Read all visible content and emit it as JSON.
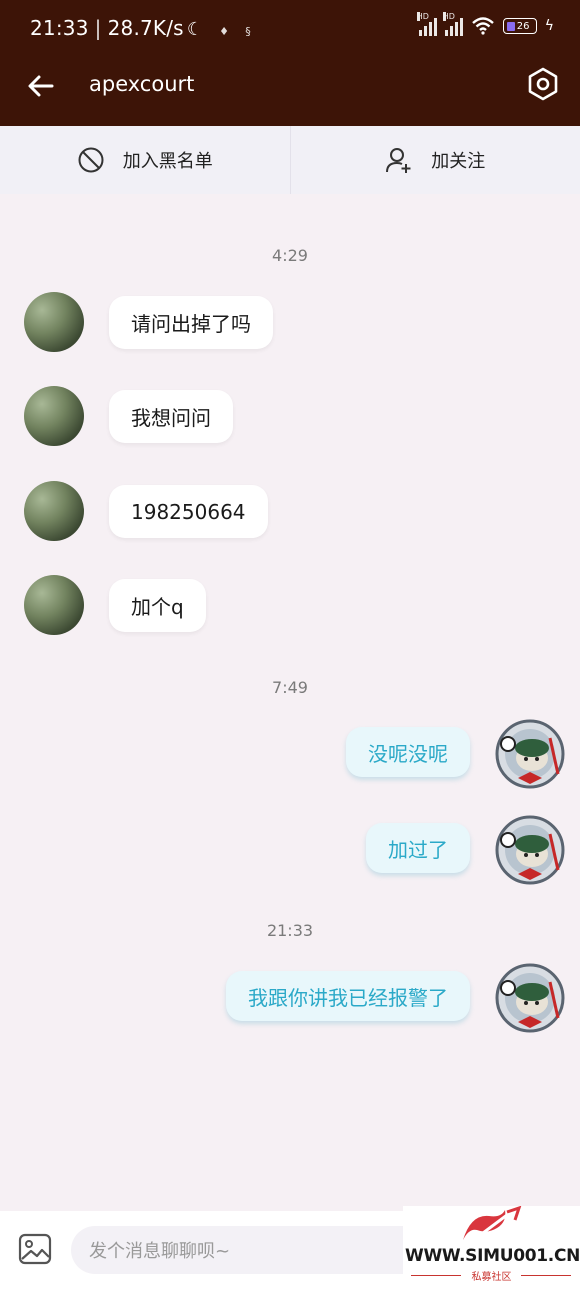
{
  "status_bar": {
    "time": "21:33",
    "separator": "|",
    "speed": "28.7K/s",
    "network_badge": "HD",
    "battery": "26"
  },
  "header": {
    "title": "apexcourt"
  },
  "actions": {
    "block_label": "加入黑名单",
    "follow_label": "加关注"
  },
  "messages": {
    "time1": "4:29",
    "m1": "请问出掉了吗",
    "m2": "我想问问",
    "m3": "198250664",
    "m4": "加个q",
    "time2": "7:49",
    "r1": "没呢没呢",
    "r2": "加过了",
    "time3": "21:33",
    "r3": "我跟你讲我已经报警了"
  },
  "input": {
    "placeholder": "发个消息聊聊呗~"
  },
  "watermark": {
    "site": "WWW.SIMU001.CN",
    "sub": "私募社区"
  },
  "colors": {
    "header_bg": "#3d1407",
    "page_bg": "#f6f0f4",
    "sent_text": "#2ba9c8",
    "sent_bubble": "#e8f7fb"
  }
}
